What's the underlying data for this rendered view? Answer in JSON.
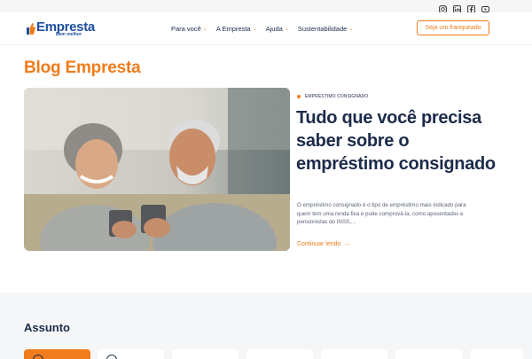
{
  "brand": {
    "name": "Empresta",
    "tagline": "Bem melhor",
    "primary_color": "#1d4f9c",
    "accent_color": "#f07c1b"
  },
  "social": [
    "instagram-icon",
    "linkedin-icon",
    "facebook-icon",
    "youtube-icon"
  ],
  "nav": {
    "items": [
      {
        "label": "Para você"
      },
      {
        "label": "A Empresta"
      },
      {
        "label": "Ajuda"
      },
      {
        "label": "Sustentabilidade"
      }
    ],
    "cta_label": "Seja um franqueado"
  },
  "blog": {
    "title": "Blog Empresta",
    "featured": {
      "category": "EMPRÉSTIMO CONSIGNADO",
      "title": "Tudo que você precisa saber sobre o empréstimo consignado",
      "excerpt": "O empréstimo consignado é o tipo de empréstimo mais indicado para quem tem uma renda fixa e pode comprová-la, como aposentados e pensionistas do INSS,...",
      "read_more": "Continuar lendo"
    }
  },
  "topics": {
    "title": "Assunto"
  }
}
